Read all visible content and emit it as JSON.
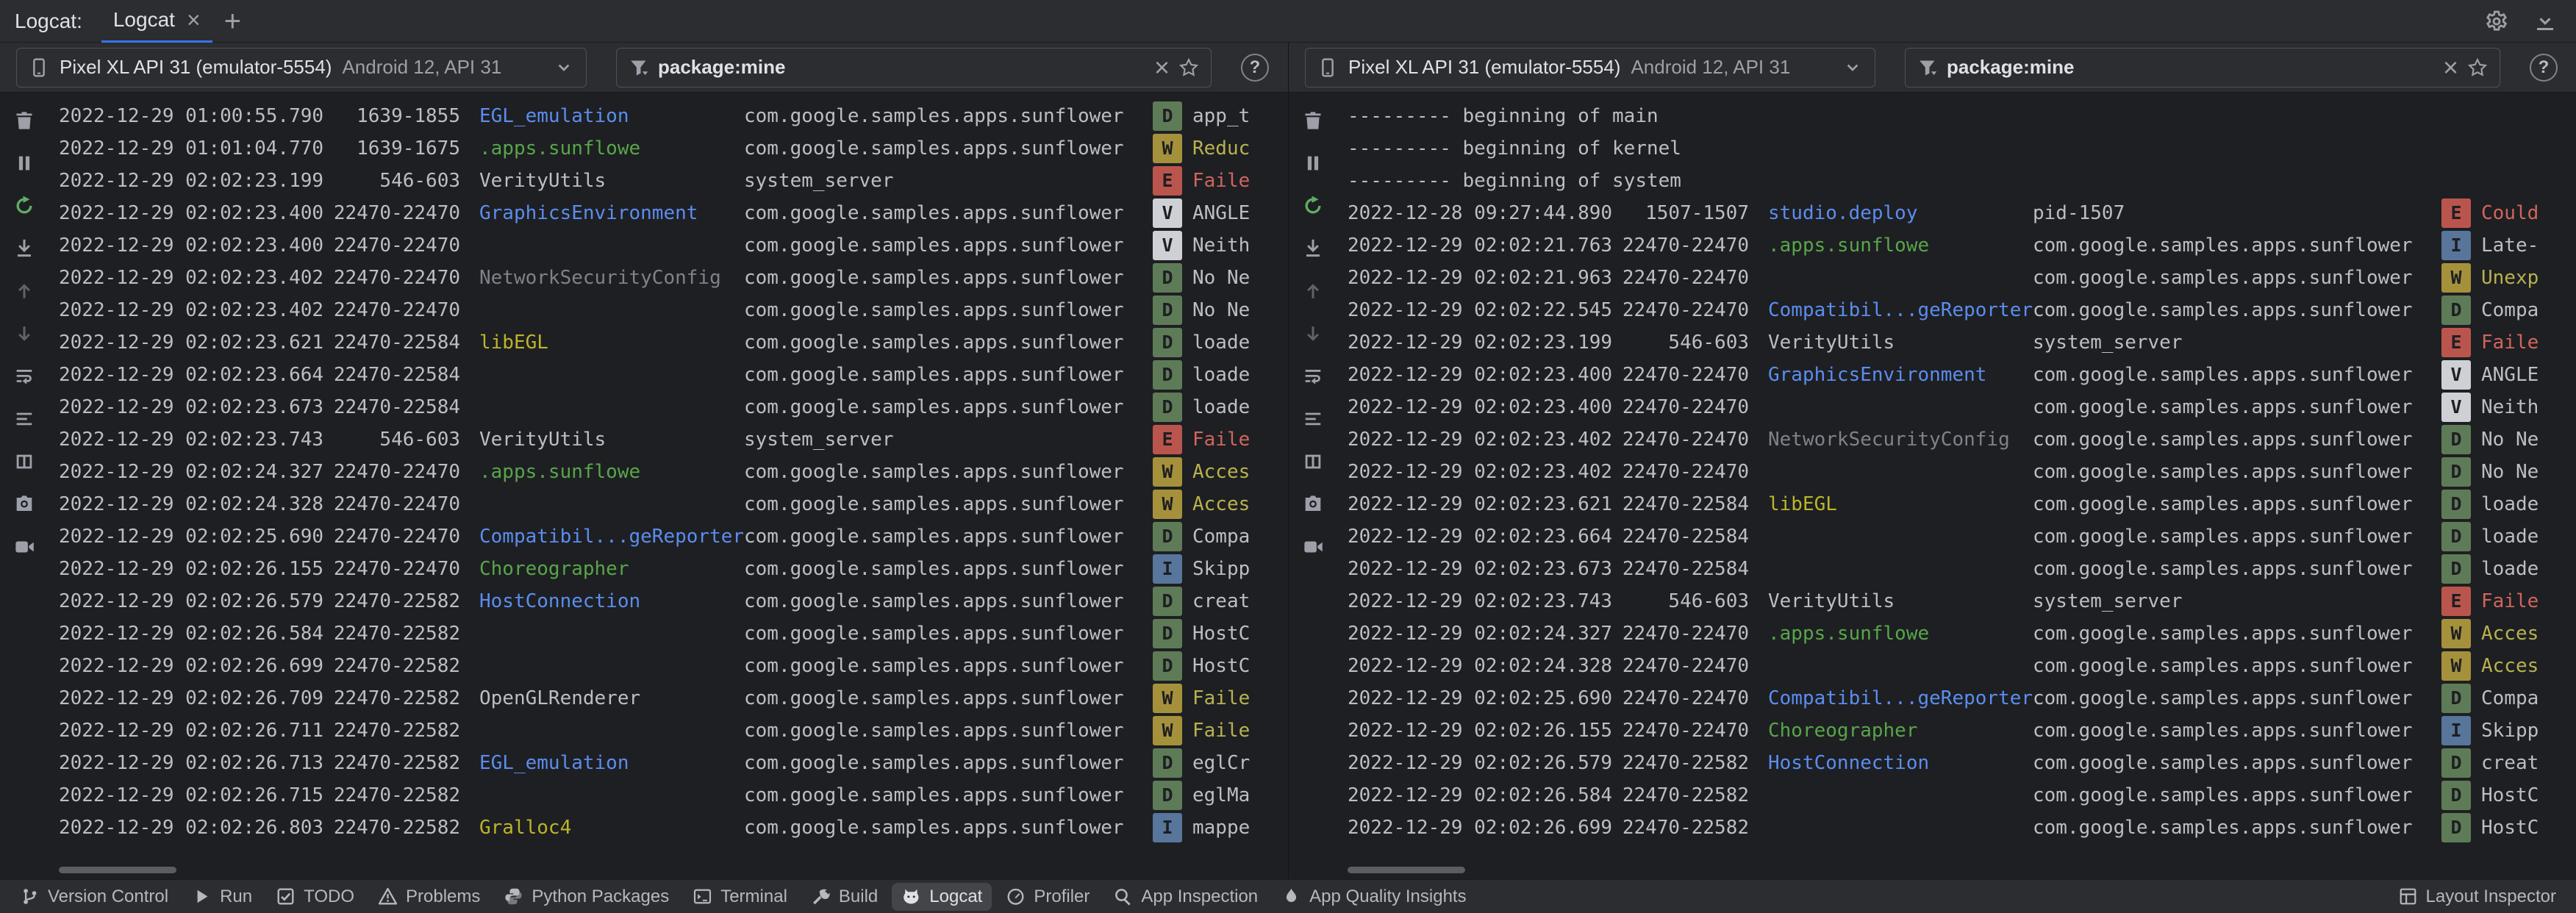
{
  "header": {
    "title": "Logcat:",
    "tabs": [
      {
        "label": "Logcat"
      }
    ],
    "close_label": "×",
    "add_tab_label": "+",
    "icons": [
      "settings-icon",
      "hide-icon"
    ]
  },
  "log_toolbar": [
    {
      "name": "clear-logcat",
      "icon": "trash"
    },
    {
      "name": "pause-logcat",
      "icon": "pause"
    },
    {
      "name": "restart-logcat",
      "icon": "restart",
      "color": "green"
    },
    {
      "name": "scroll-to-end",
      "icon": "scroll-end"
    },
    {
      "name": "previous-occurrence",
      "icon": "arrow-up",
      "dim": true
    },
    {
      "name": "next-occurrence",
      "icon": "arrow-down",
      "dim": true
    },
    {
      "name": "soft-wrap",
      "icon": "wrap"
    },
    {
      "name": "format-options",
      "icon": "format"
    },
    {
      "name": "split-panels",
      "icon": "split"
    },
    {
      "name": "take-screenshot",
      "icon": "camera"
    },
    {
      "name": "record-screen",
      "icon": "video"
    }
  ],
  "panes": [
    {
      "device_name": "Pixel XL API 31 (emulator-5554)",
      "device_details": "Android 12, API 31",
      "filter_value": "package:mine",
      "rows": [
        {
          "t": "2022-12-29 01:00:55.790",
          "p": "1639-1855",
          "tag": "EGL_emulation",
          "tc": "blue",
          "pkg": "com.google.samples.apps.sunflower",
          "l": "D",
          "m": "app_t"
        },
        {
          "t": "2022-12-29 01:01:04.770",
          "p": "1639-1675",
          "tag": ".apps.sunflowe",
          "tc": "green",
          "pkg": "com.google.samples.apps.sunflower",
          "l": "W",
          "m": "Reduc"
        },
        {
          "t": "2022-12-29 02:02:23.199",
          "p": "546-603",
          "tag": "VerityUtils",
          "tc": "def",
          "pkg": "system_server",
          "l": "E",
          "m": "Faile"
        },
        {
          "t": "2022-12-29 02:02:23.400",
          "p": "22470-22470",
          "tag": "GraphicsEnvironment",
          "tc": "blue",
          "pkg": "com.google.samples.apps.sunflower",
          "l": "V",
          "m": "ANGLE"
        },
        {
          "t": "2022-12-29 02:02:23.400",
          "p": "22470-22470",
          "tag": "",
          "tc": "def",
          "pkg": "com.google.samples.apps.sunflower",
          "l": "V",
          "m": "Neith"
        },
        {
          "t": "2022-12-29 02:02:23.402",
          "p": "22470-22470",
          "tag": "NetworkSecurityConfig",
          "tc": "gray",
          "pkg": "com.google.samples.apps.sunflower",
          "l": "D",
          "m": "No Ne"
        },
        {
          "t": "2022-12-29 02:02:23.402",
          "p": "22470-22470",
          "tag": "",
          "tc": "def",
          "pkg": "com.google.samples.apps.sunflower",
          "l": "D",
          "m": "No Ne"
        },
        {
          "t": "2022-12-29 02:02:23.621",
          "p": "22470-22584",
          "tag": "libEGL",
          "tc": "yellow",
          "pkg": "com.google.samples.apps.sunflower",
          "l": "D",
          "m": "loade"
        },
        {
          "t": "2022-12-29 02:02:23.664",
          "p": "22470-22584",
          "tag": "",
          "tc": "def",
          "pkg": "com.google.samples.apps.sunflower",
          "l": "D",
          "m": "loade"
        },
        {
          "t": "2022-12-29 02:02:23.673",
          "p": "22470-22584",
          "tag": "",
          "tc": "def",
          "pkg": "com.google.samples.apps.sunflower",
          "l": "D",
          "m": "loade"
        },
        {
          "t": "2022-12-29 02:02:23.743",
          "p": "546-603",
          "tag": "VerityUtils",
          "tc": "def",
          "pkg": "system_server",
          "l": "E",
          "m": "Faile"
        },
        {
          "t": "2022-12-29 02:02:24.327",
          "p": "22470-22470",
          "tag": ".apps.sunflowe",
          "tc": "green",
          "pkg": "com.google.samples.apps.sunflower",
          "l": "W",
          "m": "Acces"
        },
        {
          "t": "2022-12-29 02:02:24.328",
          "p": "22470-22470",
          "tag": "",
          "tc": "def",
          "pkg": "com.google.samples.apps.sunflower",
          "l": "W",
          "m": "Acces"
        },
        {
          "t": "2022-12-29 02:02:25.690",
          "p": "22470-22470",
          "tag": "Compatibil...geReporter",
          "tc": "blue",
          "pkg": "com.google.samples.apps.sunflower",
          "l": "D",
          "m": "Compa"
        },
        {
          "t": "2022-12-29 02:02:26.155",
          "p": "22470-22470",
          "tag": "Choreographer",
          "tc": "green",
          "pkg": "com.google.samples.apps.sunflower",
          "l": "I",
          "m": "Skipp"
        },
        {
          "t": "2022-12-29 02:02:26.579",
          "p": "22470-22582",
          "tag": "HostConnection",
          "tc": "blue",
          "pkg": "com.google.samples.apps.sunflower",
          "l": "D",
          "m": "creat"
        },
        {
          "t": "2022-12-29 02:02:26.584",
          "p": "22470-22582",
          "tag": "",
          "tc": "def",
          "pkg": "com.google.samples.apps.sunflower",
          "l": "D",
          "m": "HostC"
        },
        {
          "t": "2022-12-29 02:02:26.699",
          "p": "22470-22582",
          "tag": "",
          "tc": "def",
          "pkg": "com.google.samples.apps.sunflower",
          "l": "D",
          "m": "HostC"
        },
        {
          "t": "2022-12-29 02:02:26.709",
          "p": "22470-22582",
          "tag": "OpenGLRenderer",
          "tc": "def",
          "pkg": "com.google.samples.apps.sunflower",
          "l": "W",
          "m": "Faile"
        },
        {
          "t": "2022-12-29 02:02:26.711",
          "p": "22470-22582",
          "tag": "",
          "tc": "def",
          "pkg": "com.google.samples.apps.sunflower",
          "l": "W",
          "m": "Faile"
        },
        {
          "t": "2022-12-29 02:02:26.713",
          "p": "22470-22582",
          "tag": "EGL_emulation",
          "tc": "blue",
          "pkg": "com.google.samples.apps.sunflower",
          "l": "D",
          "m": "eglCr"
        },
        {
          "t": "2022-12-29 02:02:26.715",
          "p": "22470-22582",
          "tag": "",
          "tc": "def",
          "pkg": "com.google.samples.apps.sunflower",
          "l": "D",
          "m": "eglMa"
        },
        {
          "t": "2022-12-29 02:02:26.803",
          "p": "22470-22582",
          "tag": "Gralloc4",
          "tc": "yellow",
          "pkg": "com.google.samples.apps.sunflower",
          "l": "I",
          "m": "mappe"
        }
      ]
    },
    {
      "device_name": "Pixel XL API 31 (emulator-5554)",
      "device_details": "Android 12, API 31",
      "filter_value": "package:mine",
      "rows": [
        {
          "sep": "--------- beginning of main"
        },
        {
          "sep": "--------- beginning of kernel"
        },
        {
          "sep": "--------- beginning of system"
        },
        {
          "t": "2022-12-28 09:27:44.890",
          "p": "1507-1507",
          "tag": "studio.deploy",
          "tc": "blue",
          "pkg": "pid-1507",
          "l": "E",
          "m": "Could"
        },
        {
          "t": "2022-12-29 02:02:21.763",
          "p": "22470-22470",
          "tag": ".apps.sunflowe",
          "tc": "green",
          "pkg": "com.google.samples.apps.sunflower",
          "l": "I",
          "m": "Late-"
        },
        {
          "t": "2022-12-29 02:02:21.963",
          "p": "22470-22470",
          "tag": "",
          "tc": "def",
          "pkg": "com.google.samples.apps.sunflower",
          "l": "W",
          "m": "Unexp"
        },
        {
          "t": "2022-12-29 02:02:22.545",
          "p": "22470-22470",
          "tag": "Compatibil...geReporter",
          "tc": "blue",
          "pkg": "com.google.samples.apps.sunflower",
          "l": "D",
          "m": "Compa"
        },
        {
          "t": "2022-12-29 02:02:23.199",
          "p": "546-603",
          "tag": "VerityUtils",
          "tc": "def",
          "pkg": "system_server",
          "l": "E",
          "m": "Faile"
        },
        {
          "t": "2022-12-29 02:02:23.400",
          "p": "22470-22470",
          "tag": "GraphicsEnvironment",
          "tc": "blue",
          "pkg": "com.google.samples.apps.sunflower",
          "l": "V",
          "m": "ANGLE"
        },
        {
          "t": "2022-12-29 02:02:23.400",
          "p": "22470-22470",
          "tag": "",
          "tc": "def",
          "pkg": "com.google.samples.apps.sunflower",
          "l": "V",
          "m": "Neith"
        },
        {
          "t": "2022-12-29 02:02:23.402",
          "p": "22470-22470",
          "tag": "NetworkSecurityConfig",
          "tc": "gray",
          "pkg": "com.google.samples.apps.sunflower",
          "l": "D",
          "m": "No Ne"
        },
        {
          "t": "2022-12-29 02:02:23.402",
          "p": "22470-22470",
          "tag": "",
          "tc": "def",
          "pkg": "com.google.samples.apps.sunflower",
          "l": "D",
          "m": "No Ne"
        },
        {
          "t": "2022-12-29 02:02:23.621",
          "p": "22470-22584",
          "tag": "libEGL",
          "tc": "yellow",
          "pkg": "com.google.samples.apps.sunflower",
          "l": "D",
          "m": "loade"
        },
        {
          "t": "2022-12-29 02:02:23.664",
          "p": "22470-22584",
          "tag": "",
          "tc": "def",
          "pkg": "com.google.samples.apps.sunflower",
          "l": "D",
          "m": "loade"
        },
        {
          "t": "2022-12-29 02:02:23.673",
          "p": "22470-22584",
          "tag": "",
          "tc": "def",
          "pkg": "com.google.samples.apps.sunflower",
          "l": "D",
          "m": "loade"
        },
        {
          "t": "2022-12-29 02:02:23.743",
          "p": "546-603",
          "tag": "VerityUtils",
          "tc": "def",
          "pkg": "system_server",
          "l": "E",
          "m": "Faile"
        },
        {
          "t": "2022-12-29 02:02:24.327",
          "p": "22470-22470",
          "tag": ".apps.sunflowe",
          "tc": "green",
          "pkg": "com.google.samples.apps.sunflower",
          "l": "W",
          "m": "Acces"
        },
        {
          "t": "2022-12-29 02:02:24.328",
          "p": "22470-22470",
          "tag": "",
          "tc": "def",
          "pkg": "com.google.samples.apps.sunflower",
          "l": "W",
          "m": "Acces"
        },
        {
          "t": "2022-12-29 02:02:25.690",
          "p": "22470-22470",
          "tag": "Compatibil...geReporter",
          "tc": "blue",
          "pkg": "com.google.samples.apps.sunflower",
          "l": "D",
          "m": "Compa"
        },
        {
          "t": "2022-12-29 02:02:26.155",
          "p": "22470-22470",
          "tag": "Choreographer",
          "tc": "green",
          "pkg": "com.google.samples.apps.sunflower",
          "l": "I",
          "m": "Skipp"
        },
        {
          "t": "2022-12-29 02:02:26.579",
          "p": "22470-22582",
          "tag": "HostConnection",
          "tc": "blue",
          "pkg": "com.google.samples.apps.sunflower",
          "l": "D",
          "m": "creat"
        },
        {
          "t": "2022-12-29 02:02:26.584",
          "p": "22470-22582",
          "tag": "",
          "tc": "def",
          "pkg": "com.google.samples.apps.sunflower",
          "l": "D",
          "m": "HostC"
        },
        {
          "t": "2022-12-29 02:02:26.699",
          "p": "22470-22582",
          "tag": "",
          "tc": "def",
          "pkg": "com.google.samples.apps.sunflower",
          "l": "D",
          "m": "HostC"
        }
      ]
    }
  ],
  "statusbar": {
    "left": [
      {
        "label": "Version Control",
        "icon": "branch"
      },
      {
        "label": "Run",
        "icon": "play"
      },
      {
        "label": "TODO",
        "icon": "todo"
      },
      {
        "label": "Problems",
        "icon": "warning"
      },
      {
        "label": "Python Packages",
        "icon": "python"
      },
      {
        "label": "Terminal",
        "icon": "terminal"
      },
      {
        "label": "Build",
        "icon": "build"
      },
      {
        "label": "Logcat",
        "icon": "cat",
        "active": true
      },
      {
        "label": "Profiler",
        "icon": "profiler"
      },
      {
        "label": "App Inspection",
        "icon": "inspect"
      },
      {
        "label": "App Quality Insights",
        "icon": "aqi"
      }
    ],
    "right": [
      {
        "label": "Layout Inspector",
        "icon": "layout"
      }
    ]
  },
  "colors": {
    "level_verbose_bg": "#CED0D6",
    "level_debug_bg": "#5E7B58",
    "level_info_bg": "#58759C",
    "level_warn_bg": "#A5913C",
    "level_error_bg": "#BA554D",
    "tag_blue": "#5B8DEF",
    "tag_green": "#57A64A",
    "tag_yellow": "#BBB529",
    "tag_gray": "#7D828B",
    "warn_text": "#B8B24F",
    "error_text": "#D0655C",
    "log_text": "#BCBEC4",
    "panel_bg": "#2B2D30",
    "editor_bg": "#1E1F22",
    "tab_accent": "#3574F0",
    "restart_green": "#57965C"
  }
}
